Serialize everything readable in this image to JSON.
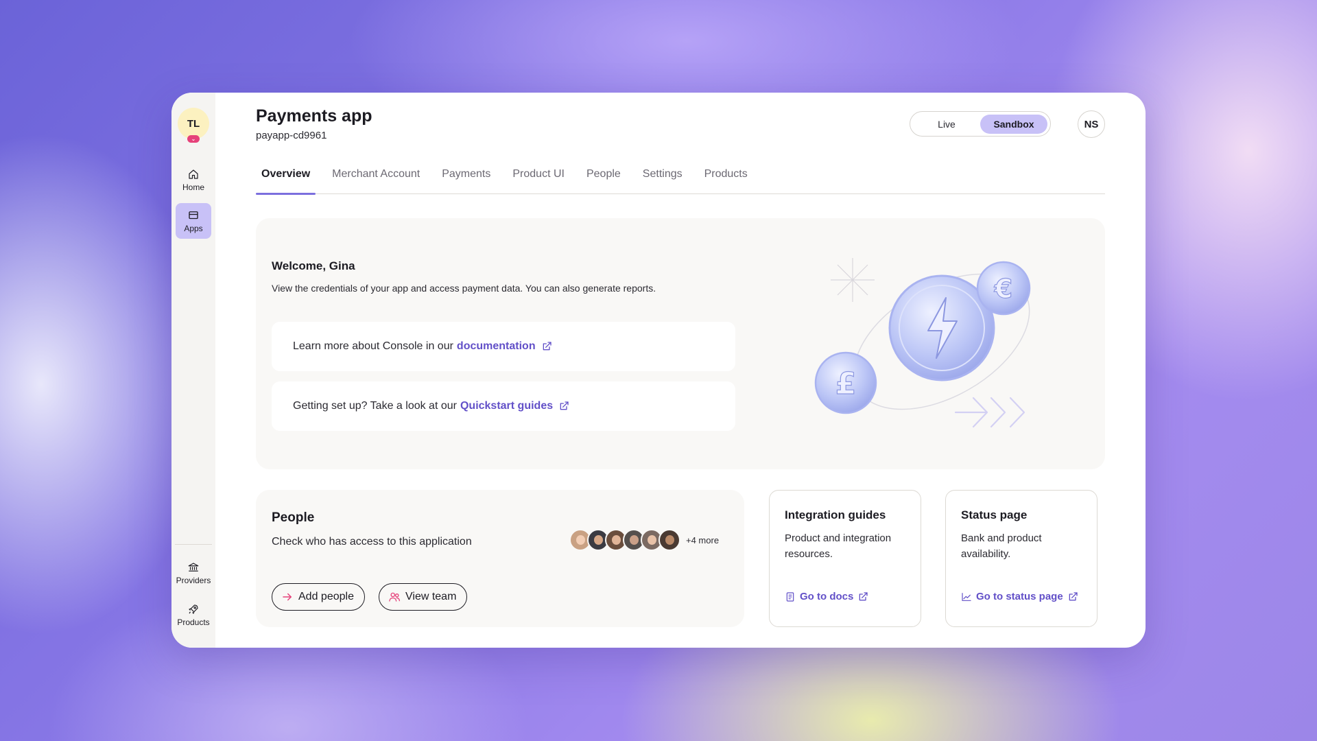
{
  "sidebar": {
    "user_initials": "TL",
    "items": [
      {
        "label": "Home",
        "icon": "home-icon"
      },
      {
        "label": "Apps",
        "icon": "apps-icon",
        "active": true
      },
      {
        "label": "Providers",
        "icon": "bank-icon"
      },
      {
        "label": "Products",
        "icon": "rocket-icon"
      }
    ]
  },
  "header": {
    "title": "Payments app",
    "app_id": "payapp-cd9961",
    "mode_toggle": {
      "live": "Live",
      "sandbox": "Sandbox",
      "selected": "Sandbox"
    },
    "profile_initials": "NS"
  },
  "tabs": [
    {
      "label": "Overview",
      "active": true
    },
    {
      "label": "Merchant Account"
    },
    {
      "label": "Payments"
    },
    {
      "label": "Product UI"
    },
    {
      "label": "People"
    },
    {
      "label": "Settings"
    },
    {
      "label": "Products"
    }
  ],
  "welcome": {
    "title": "Welcome, Gina",
    "description": "View the credentials of your app and access payment data. You can also generate reports.",
    "links": [
      {
        "text": "Learn more about Console in our",
        "link_label": "documentation"
      },
      {
        "text": "Getting set up? Take a look at our",
        "link_label": "Quickstart guides"
      }
    ]
  },
  "people": {
    "title": "People",
    "description": "Check who has access to this application",
    "more_count": "+4 more",
    "add_button": "Add people",
    "view_button": "View team"
  },
  "integration": {
    "title": "Integration guides",
    "description": "Product and integration resources.",
    "link_label": "Go to docs"
  },
  "status": {
    "title": "Status page",
    "description": "Bank and product availability.",
    "link_label": "Go to status page"
  },
  "colors": {
    "accent": "#c8c1f7",
    "link": "#6250c8",
    "tab_underline": "#7b6fde"
  }
}
